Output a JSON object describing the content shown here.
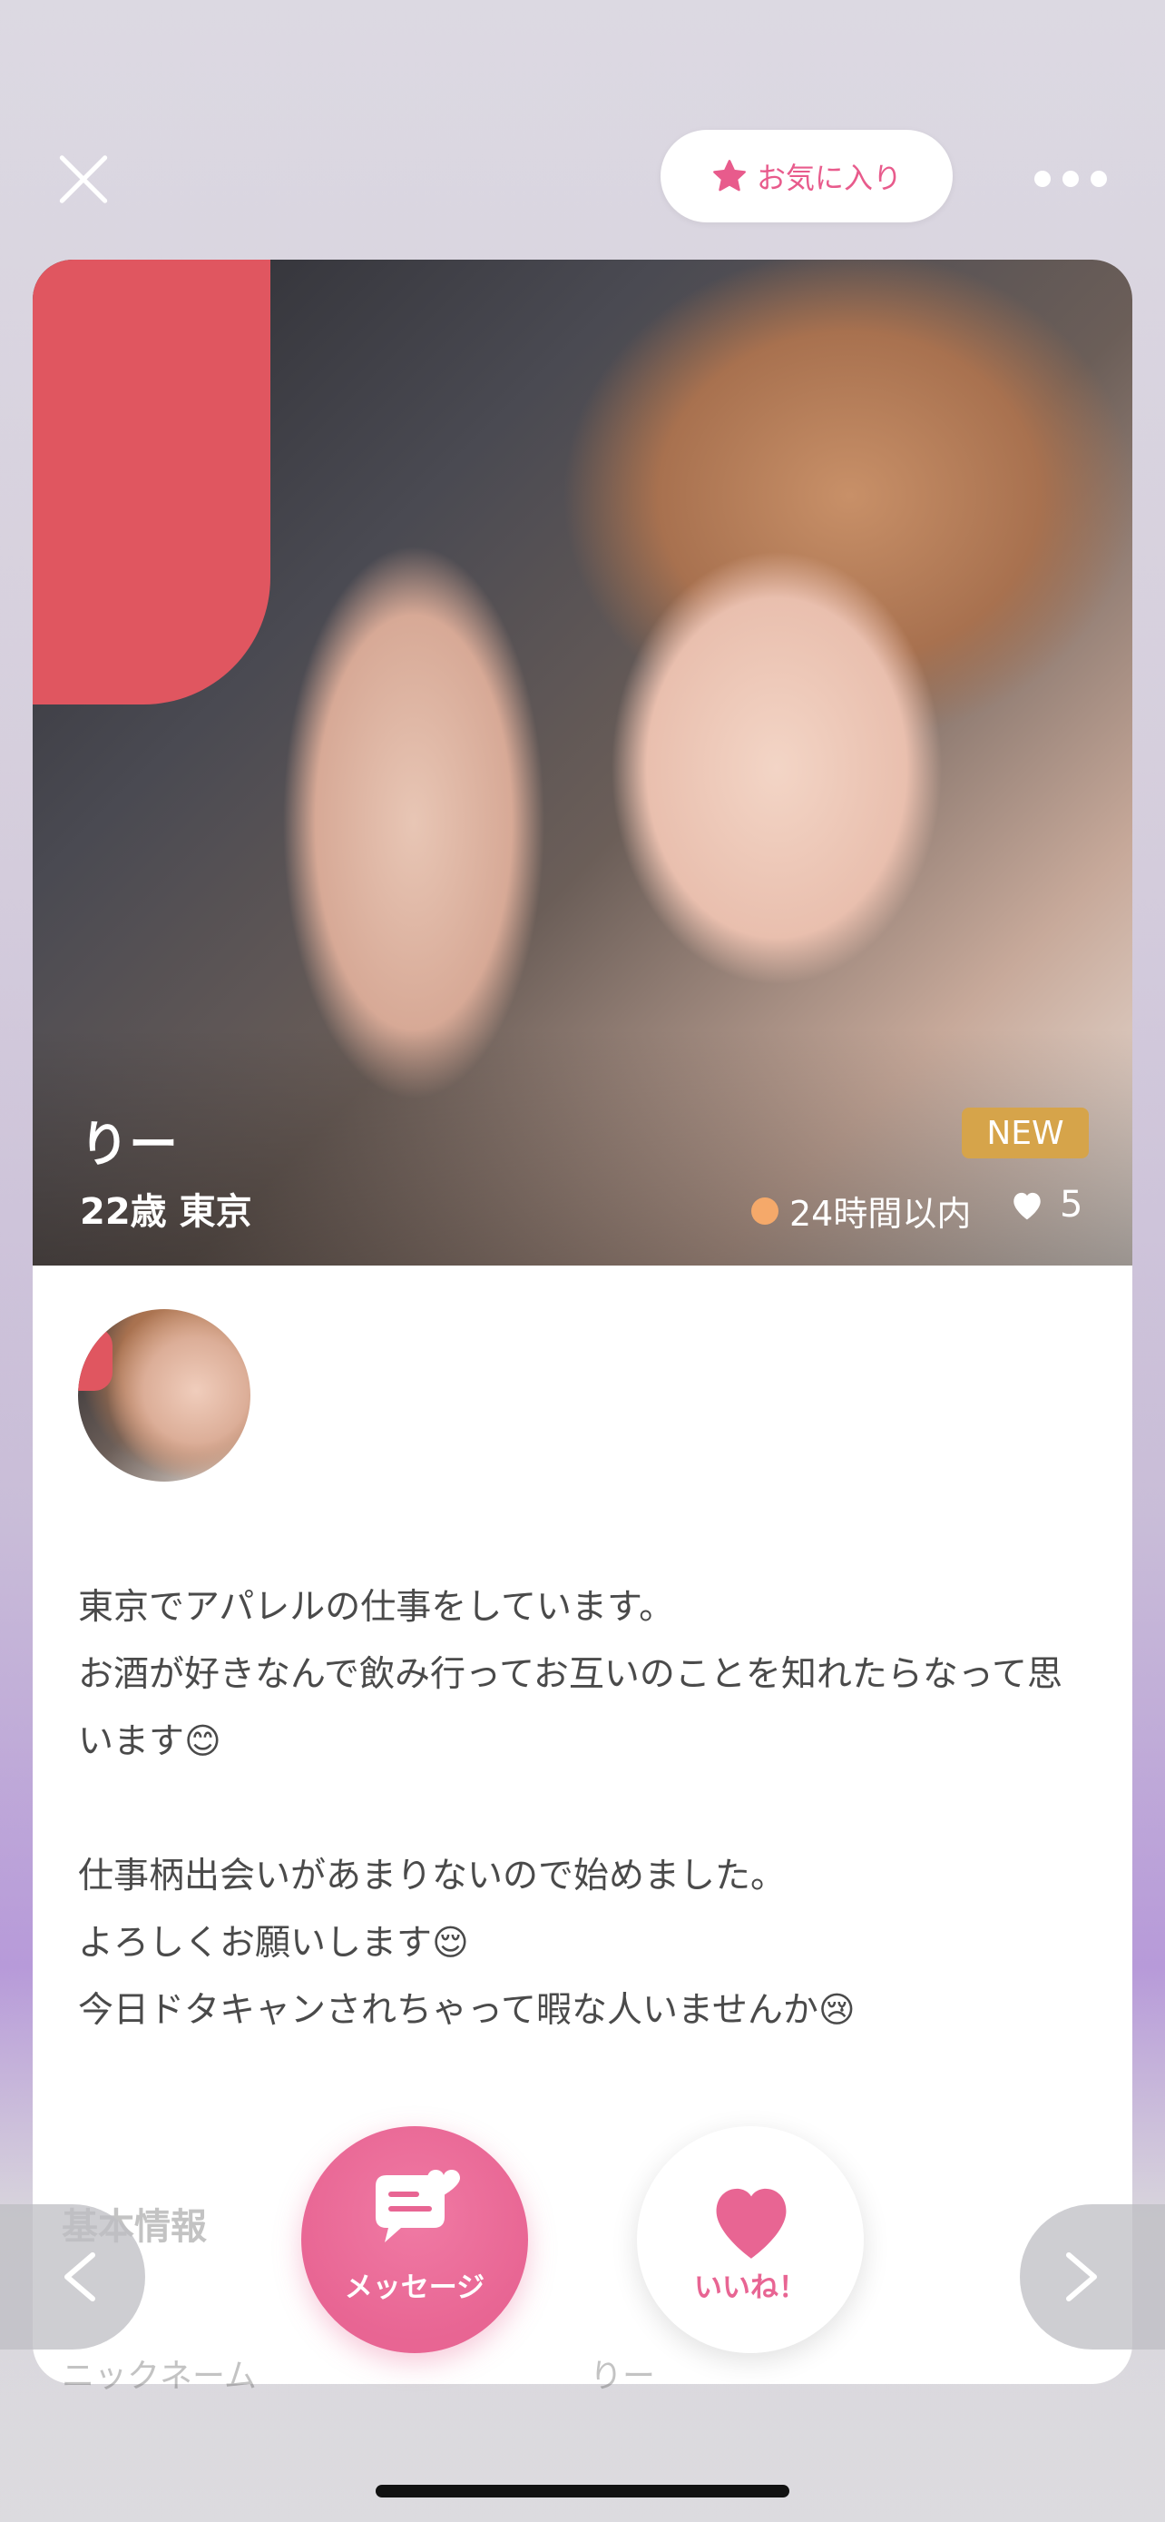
{
  "header": {
    "favorite_label": "お気に入り"
  },
  "profile": {
    "name": "りー",
    "age_city": "22歳 東京",
    "badge": "NEW",
    "status": "24時間以内",
    "likes": "5",
    "bio": [
      "東京でアパレルの仕事をしています。",
      "お酒が好きなんで飲み行ってお互いのことを知れたらなって思います😊",
      "",
      "仕事柄出会いがあまりないので始めました。",
      "よろしくお願いします😌",
      "今日ドタキャンされちゃって暇な人いませんか😢"
    ]
  },
  "basic_info": {
    "title": "基本情報",
    "nickname_label": "ニックネーム",
    "nickname_value": "りー"
  },
  "actions": {
    "message_label": "メッセージ",
    "like_label": "いいね！"
  },
  "colors": {
    "accent": "#e86593",
    "badge": "#d6a44a",
    "status_dot": "#f5a96a"
  }
}
